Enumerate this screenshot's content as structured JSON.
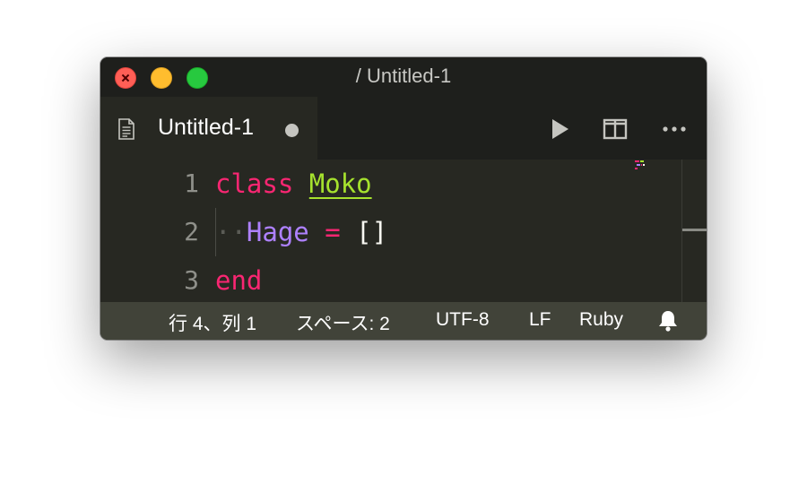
{
  "window": {
    "title": "/ Untitled-1"
  },
  "tab": {
    "label": "Untitled-1",
    "dirty": true,
    "icon": "file-icon"
  },
  "actions": [
    {
      "name": "run",
      "icon": "play-icon"
    },
    {
      "name": "split-editor",
      "icon": "split-editor-icon"
    },
    {
      "name": "more",
      "icon": "more-icon"
    }
  ],
  "editor": {
    "language": "ruby",
    "lines": [
      {
        "number": "1",
        "tokens": [
          {
            "text": "class",
            "type": "keyword"
          },
          {
            "text": " ",
            "type": "plain"
          },
          {
            "text": "Moko",
            "type": "class-name"
          }
        ]
      },
      {
        "number": "2",
        "tokens": [
          {
            "text": "··",
            "type": "whitespace"
          },
          {
            "text": "Hage",
            "type": "constant"
          },
          {
            "text": " ",
            "type": "plain"
          },
          {
            "text": "=",
            "type": "operator"
          },
          {
            "text": " ",
            "type": "plain"
          },
          {
            "text": "[]",
            "type": "plain"
          }
        ]
      },
      {
        "number": "3",
        "tokens": [
          {
            "text": "end",
            "type": "keyword"
          }
        ]
      }
    ]
  },
  "statusbar": {
    "position": "行 4、列 1",
    "indentation": "スペース: 2",
    "encoding": "UTF-8",
    "eol": "LF",
    "language": "Ruby",
    "notifications_icon": "bell-icon"
  },
  "colors": {
    "background": "#272822",
    "titlebar": "#1e1f1c",
    "statusbar": "#414339",
    "keyword": "#f92672",
    "class_name": "#a6e22e",
    "constant": "#ae81ff",
    "text": "#f8f8f2"
  }
}
